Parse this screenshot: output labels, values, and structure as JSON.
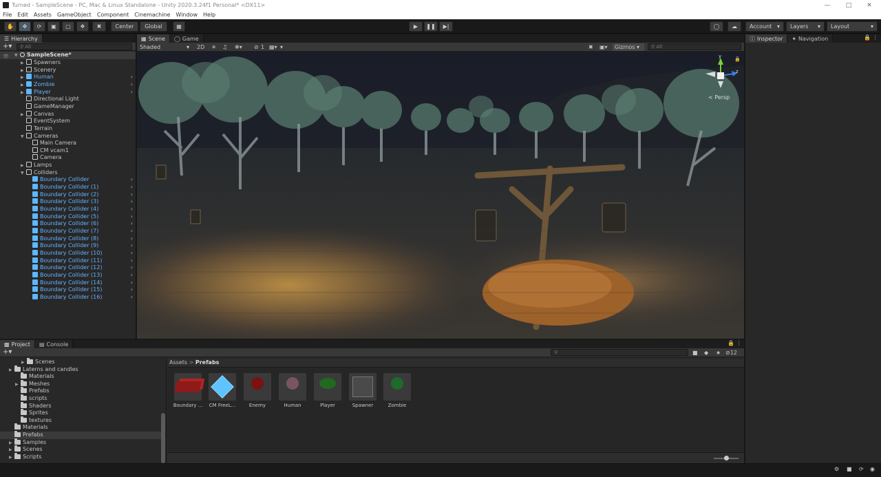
{
  "window": {
    "title": "Turned - SampleScene - PC, Mac & Linux Standalone - Unity 2020.3.24f1 Personal* <DX11>"
  },
  "menu": [
    "File",
    "Edit",
    "Assets",
    "GameObject",
    "Component",
    "Cinemachine",
    "Window",
    "Help"
  ],
  "toolbar": {
    "center_label": "Center",
    "global_label": "Global",
    "account_label": "Account",
    "layers_label": "Layers",
    "layout_label": "Layout"
  },
  "hierarchy": {
    "tab": "Hierarchy",
    "search_placeholder": "All",
    "scene": "SampleScene*",
    "items": [
      {
        "label": "Spawners",
        "blue": false,
        "arrow": true,
        "indent": 1
      },
      {
        "label": "Scenery",
        "blue": false,
        "arrow": true,
        "indent": 1
      },
      {
        "label": "Human",
        "blue": true,
        "arrow": true,
        "indent": 1
      },
      {
        "label": "Zombie",
        "blue": true,
        "arrow": true,
        "indent": 1
      },
      {
        "label": "Player",
        "blue": true,
        "arrow": true,
        "indent": 1
      },
      {
        "label": "Directional Light",
        "blue": false,
        "arrow": false,
        "indent": 1
      },
      {
        "label": "GameManager",
        "blue": false,
        "arrow": false,
        "indent": 1
      },
      {
        "label": "Canvas",
        "blue": false,
        "arrow": true,
        "indent": 1
      },
      {
        "label": "EventSystem",
        "blue": false,
        "arrow": false,
        "indent": 1
      },
      {
        "label": "Terrain",
        "blue": false,
        "arrow": false,
        "indent": 1
      },
      {
        "label": "Cameras",
        "blue": false,
        "arrow": true,
        "open": true,
        "indent": 1
      },
      {
        "label": "Main Camera",
        "blue": false,
        "arrow": false,
        "indent": 2
      },
      {
        "label": "CM vcam1",
        "blue": false,
        "arrow": false,
        "indent": 2
      },
      {
        "label": "Camera",
        "blue": false,
        "arrow": false,
        "indent": 2
      },
      {
        "label": "Lamps",
        "blue": false,
        "arrow": true,
        "indent": 1
      },
      {
        "label": "Colliders",
        "blue": false,
        "arrow": true,
        "open": true,
        "indent": 1
      },
      {
        "label": "Boundary Collider",
        "blue": true,
        "arrow": false,
        "indent": 2
      },
      {
        "label": "Boundary Collider (1)",
        "blue": true,
        "arrow": false,
        "indent": 2
      },
      {
        "label": "Boundary Collider (2)",
        "blue": true,
        "arrow": false,
        "indent": 2
      },
      {
        "label": "Boundary Collider (3)",
        "blue": true,
        "arrow": false,
        "indent": 2
      },
      {
        "label": "Boundary Collider (4)",
        "blue": true,
        "arrow": false,
        "indent": 2
      },
      {
        "label": "Boundary Collider (5)",
        "blue": true,
        "arrow": false,
        "indent": 2
      },
      {
        "label": "Boundary Collider (6)",
        "blue": true,
        "arrow": false,
        "indent": 2
      },
      {
        "label": "Boundary Collider (7)",
        "blue": true,
        "arrow": false,
        "indent": 2
      },
      {
        "label": "Boundary Collider (8)",
        "blue": true,
        "arrow": false,
        "indent": 2
      },
      {
        "label": "Boundary Collider (9)",
        "blue": true,
        "arrow": false,
        "indent": 2
      },
      {
        "label": "Boundary Collider (10)",
        "blue": true,
        "arrow": false,
        "indent": 2
      },
      {
        "label": "Boundary Collider (11)",
        "blue": true,
        "arrow": false,
        "indent": 2
      },
      {
        "label": "Boundary Collider (12)",
        "blue": true,
        "arrow": false,
        "indent": 2
      },
      {
        "label": "Boundary Collider (13)",
        "blue": true,
        "arrow": false,
        "indent": 2
      },
      {
        "label": "Boundary Collider (14)",
        "blue": true,
        "arrow": false,
        "indent": 2
      },
      {
        "label": "Boundary Collider (15)",
        "blue": true,
        "arrow": false,
        "indent": 2
      },
      {
        "label": "Boundary Collider (16)",
        "blue": true,
        "arrow": false,
        "indent": 2
      }
    ]
  },
  "scene": {
    "tab_scene": "Scene",
    "tab_game": "Game",
    "shading": "Shaded",
    "mode_2d": "2D",
    "gizmos": "Gizmos",
    "search_placeholder": "All",
    "persp": "Persp",
    "visibility_count": "1"
  },
  "inspector": {
    "tab_inspector": "Inspector",
    "tab_navigation": "Navigation"
  },
  "project": {
    "tab_project": "Project",
    "tab_console": "Console",
    "breadcrumb_root": "Assets",
    "breadcrumb_sep": ">",
    "breadcrumb_current": "Prefabs",
    "hidden_count": "12",
    "tree": [
      {
        "label": "Scenes",
        "indent": 3,
        "arrow": true
      },
      {
        "label": "Laterns and candles",
        "indent": 1,
        "arrow": true
      },
      {
        "label": "Materials",
        "indent": 2,
        "arrow": false
      },
      {
        "label": "Meshes",
        "indent": 2,
        "arrow": true
      },
      {
        "label": "Prefabs",
        "indent": 2,
        "arrow": false
      },
      {
        "label": "scripts",
        "indent": 2,
        "arrow": false
      },
      {
        "label": "Shaders",
        "indent": 2,
        "arrow": false
      },
      {
        "label": "Sprites",
        "indent": 2,
        "arrow": false
      },
      {
        "label": "textures",
        "indent": 2,
        "arrow": false
      },
      {
        "label": "Materials",
        "indent": 1,
        "arrow": false
      },
      {
        "label": "Prefabs",
        "indent": 1,
        "arrow": false,
        "selected": true
      },
      {
        "label": "Samples",
        "indent": 1,
        "arrow": true
      },
      {
        "label": "Scenes",
        "indent": 1,
        "arrow": true
      },
      {
        "label": "Scripts",
        "indent": 1,
        "arrow": true
      }
    ],
    "assets": [
      {
        "label": "Boundary ...",
        "kind": "red-box"
      },
      {
        "label": "CM FreeL...",
        "kind": "blue-cube"
      },
      {
        "label": "Enemy",
        "kind": "red-sphere"
      },
      {
        "label": "Human",
        "kind": "pink-sphere"
      },
      {
        "label": "Player",
        "kind": "green-ellipse"
      },
      {
        "label": "Spawner",
        "kind": "grey-cube"
      },
      {
        "label": "Zombie",
        "kind": "green-sphere"
      }
    ]
  }
}
